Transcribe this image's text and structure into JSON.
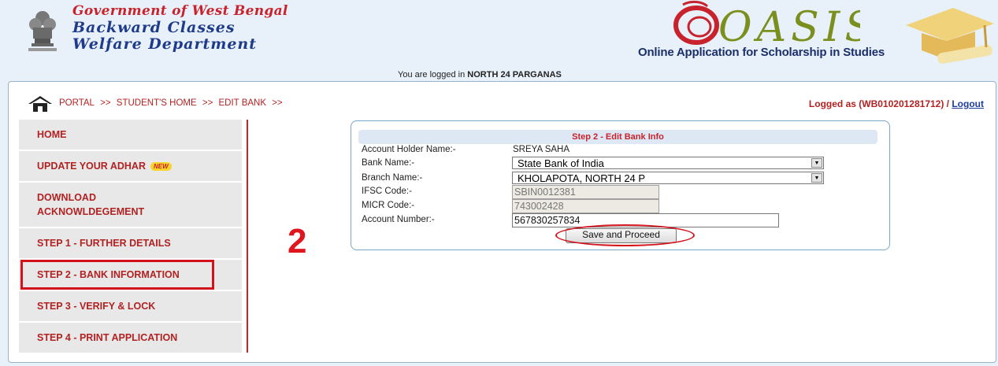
{
  "header": {
    "gov_line1": "Government of West Bengal",
    "gov_line2": "Backward Classes",
    "gov_line3": "Welfare Department",
    "oasis_logo_text": "OASIS",
    "oasis_subtitle": "Online Application for Scholarship in Studies",
    "logged_in_prefix": "You are logged in",
    "logged_in_district": "NORTH 24 PARGANAS"
  },
  "breadcrumb": {
    "items": [
      "PORTAL",
      ">>",
      "STUDENT'S HOME",
      ">>",
      "EDIT BANK",
      ">>"
    ]
  },
  "session": {
    "logged_as": "Logged as (WB010201281712) /",
    "logout_label": "Logout"
  },
  "sidebar": {
    "items": [
      {
        "label": "HOME"
      },
      {
        "label": "UPDATE YOUR ADHAR",
        "badge": "NEW"
      },
      {
        "label_line1": "DOWNLOAD",
        "label_line2": "ACKNOWLDEGEMENT"
      },
      {
        "label": "STEP 1 - FURTHER DETAILS"
      },
      {
        "label": "STEP 2 - BANK INFORMATION"
      },
      {
        "label": "STEP 3 - VERIFY & LOCK"
      },
      {
        "label": "STEP 4 - PRINT APPLICATION"
      }
    ]
  },
  "annotation": {
    "step_number": "2",
    "highlight_color": "#d3131b"
  },
  "form": {
    "title": "Step 2 - Edit Bank Info",
    "account_holder_label": "Account Holder Name:-",
    "account_holder_value": "SREYA SAHA",
    "bank_name_label": "Bank Name:-",
    "bank_name_value": "State Bank of India",
    "branch_name_label": "Branch Name:-",
    "branch_name_value": "KHOLAPOTA, NORTH 24 P",
    "ifsc_label": "IFSC Code:-",
    "ifsc_value": "SBIN0012381",
    "micr_label": "MICR Code:-",
    "micr_value": "743002428",
    "account_number_label": "Account Number:-",
    "account_number_value": "567830257834",
    "save_button_label": "Save and Proceed"
  },
  "colors": {
    "accent_red": "#b22222",
    "brand_blue": "#1e3a8a",
    "page_bg": "#e8f1f9"
  }
}
